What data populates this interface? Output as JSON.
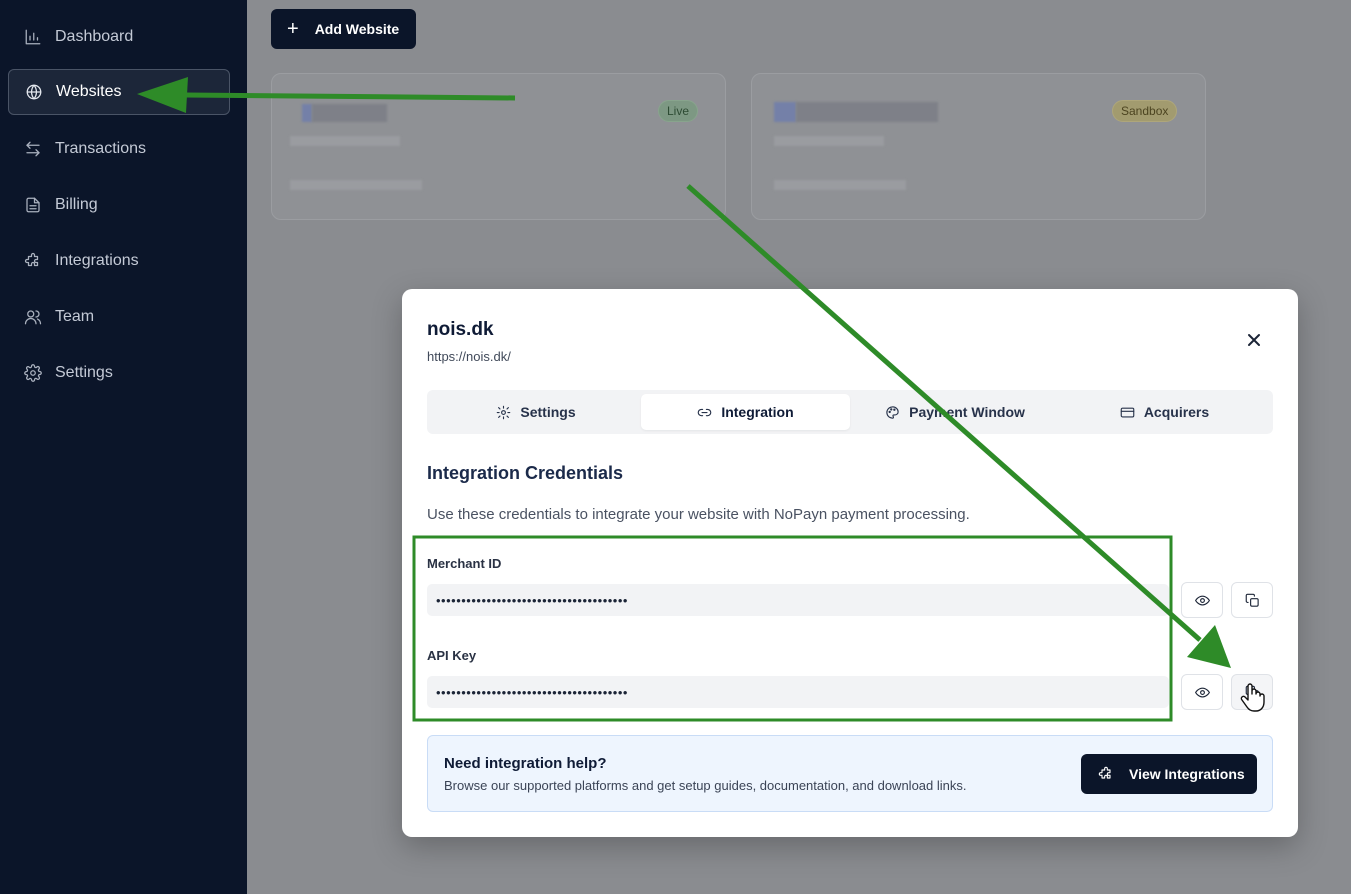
{
  "sidebar": {
    "items": [
      {
        "label": "Dashboard",
        "icon": "bar-chart-icon"
      },
      {
        "label": "Websites",
        "icon": "globe-icon",
        "active": true
      },
      {
        "label": "Transactions",
        "icon": "arrows-left-right-icon"
      },
      {
        "label": "Billing",
        "icon": "document-icon"
      },
      {
        "label": "Integrations",
        "icon": "puzzle-icon"
      },
      {
        "label": "Team",
        "icon": "users-icon"
      },
      {
        "label": "Settings",
        "icon": "gear-icon"
      }
    ]
  },
  "main": {
    "add_website_label": "Add Website",
    "cards": [
      {
        "badge": "Live"
      },
      {
        "badge": "Sandbox"
      }
    ]
  },
  "modal": {
    "title": "nois.dk",
    "url": "https://nois.dk/",
    "tabs": [
      {
        "label": "Settings",
        "icon": "gear-icon"
      },
      {
        "label": "Integration",
        "icon": "link-icon",
        "active": true
      },
      {
        "label": "Payment Window",
        "icon": "palette-icon"
      },
      {
        "label": "Acquirers",
        "icon": "credit-card-icon"
      }
    ],
    "section_title": "Integration Credentials",
    "section_desc": "Use these credentials to integrate your website with NoPayn payment processing.",
    "fields": [
      {
        "label": "Merchant ID",
        "value": "••••••••••••••••••••••••••••••••••••••"
      },
      {
        "label": "API Key",
        "value": "••••••••••••••••••••••••••••••••••••••"
      }
    ],
    "help": {
      "title": "Need integration help?",
      "desc": "Browse our supported platforms and get setup guides, documentation, and download links.",
      "button_label": "View Integrations"
    }
  },
  "colors": {
    "sidebar_bg": "#0b1529",
    "annotation_green": "#2e8b28",
    "primary_button": "#0b1529"
  }
}
